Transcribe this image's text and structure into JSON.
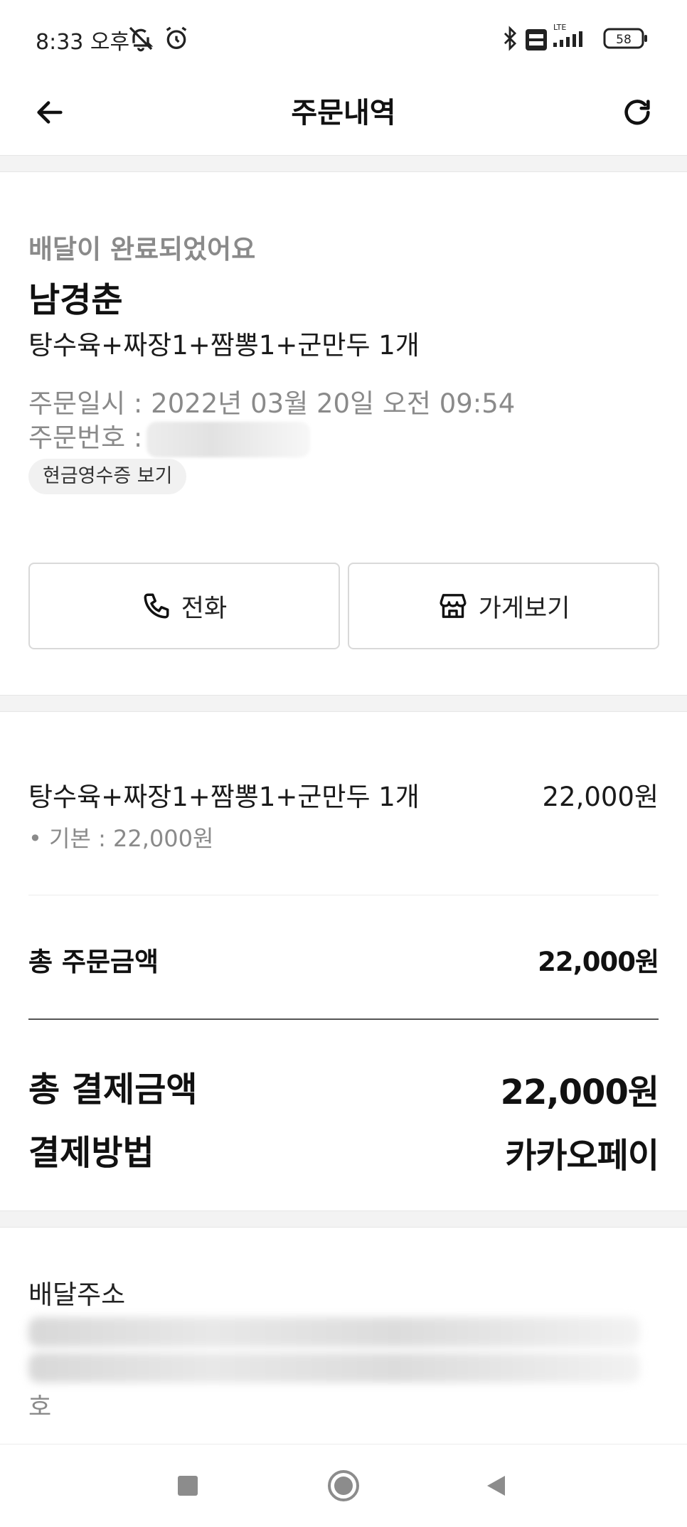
{
  "status_bar": {
    "time": "8:33 오후",
    "battery": "58",
    "network": "LTE"
  },
  "header": {
    "title": "주문내역"
  },
  "order": {
    "status_message": "배달이 완료되었어요",
    "store_name": "남경춘",
    "menu_summary": "탕수육+짜장1+짬뽕1+군만두 1개",
    "date_label": "주문일시 : 2022년 03월 20일 오전 09:54",
    "number_label": "주문번호 :",
    "receipt_button": "현금영수증 보기"
  },
  "actions": {
    "call": "전화",
    "store": "가게보기"
  },
  "items": [
    {
      "name": "탕수육+짜장1+짬뽕1+군만두 1개",
      "price": "22,000원",
      "option": "기본 : 22,000원"
    }
  ],
  "totals": {
    "order_label": "총 주문금액",
    "order_value": "22,000원",
    "payment_label": "총 결제금액",
    "payment_value": "22,000원",
    "method_label": "결제방법",
    "method_value": "카카오페이"
  },
  "address": {
    "label": "배달주소",
    "tail": "호"
  },
  "icons": {
    "back": "arrow-left-icon",
    "refresh": "refresh-icon",
    "phone": "phone-icon",
    "store": "store-icon",
    "nav_recent": "square-icon",
    "nav_home": "circle-icon",
    "nav_back": "triangle-back-icon"
  },
  "colors": {
    "text": "#1a1a1a",
    "muted": "#8a8a8a",
    "divider": "#ececec",
    "section_gap": "#f3f3f3"
  }
}
